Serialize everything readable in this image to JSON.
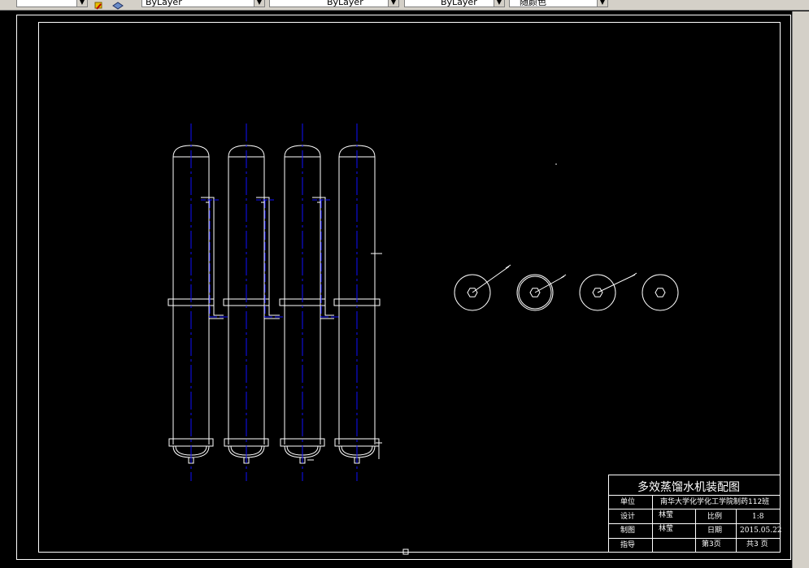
{
  "toolbar": {
    "layer_color": "ByLayer",
    "linetype": "ByLayer",
    "lineweight": "ByLayer",
    "plot_style": "随颜色"
  },
  "title_block": {
    "title": "多效蒸馏水机装配图",
    "unit_label": "单位",
    "unit_value": "南华大学化学化工学院制药112班",
    "design_label": "设计",
    "design_value": "林莹",
    "scale_label": "比例",
    "scale_value": "1:8",
    "draw_label": "制图",
    "draw_value": "林莹",
    "date_label": "日期",
    "date_value": "2015.05.22",
    "guide_label": "指导",
    "sheet_label": "第3页",
    "total_label": "共3 页"
  },
  "colors": {
    "background": "#000000",
    "line": "#ffffff",
    "centerline": "#1010ff",
    "toolbar": "#d4d0c8"
  },
  "icons": [
    "layer-properties-icon",
    "layer-state-icon",
    "dropdown-arrow-icon"
  ]
}
